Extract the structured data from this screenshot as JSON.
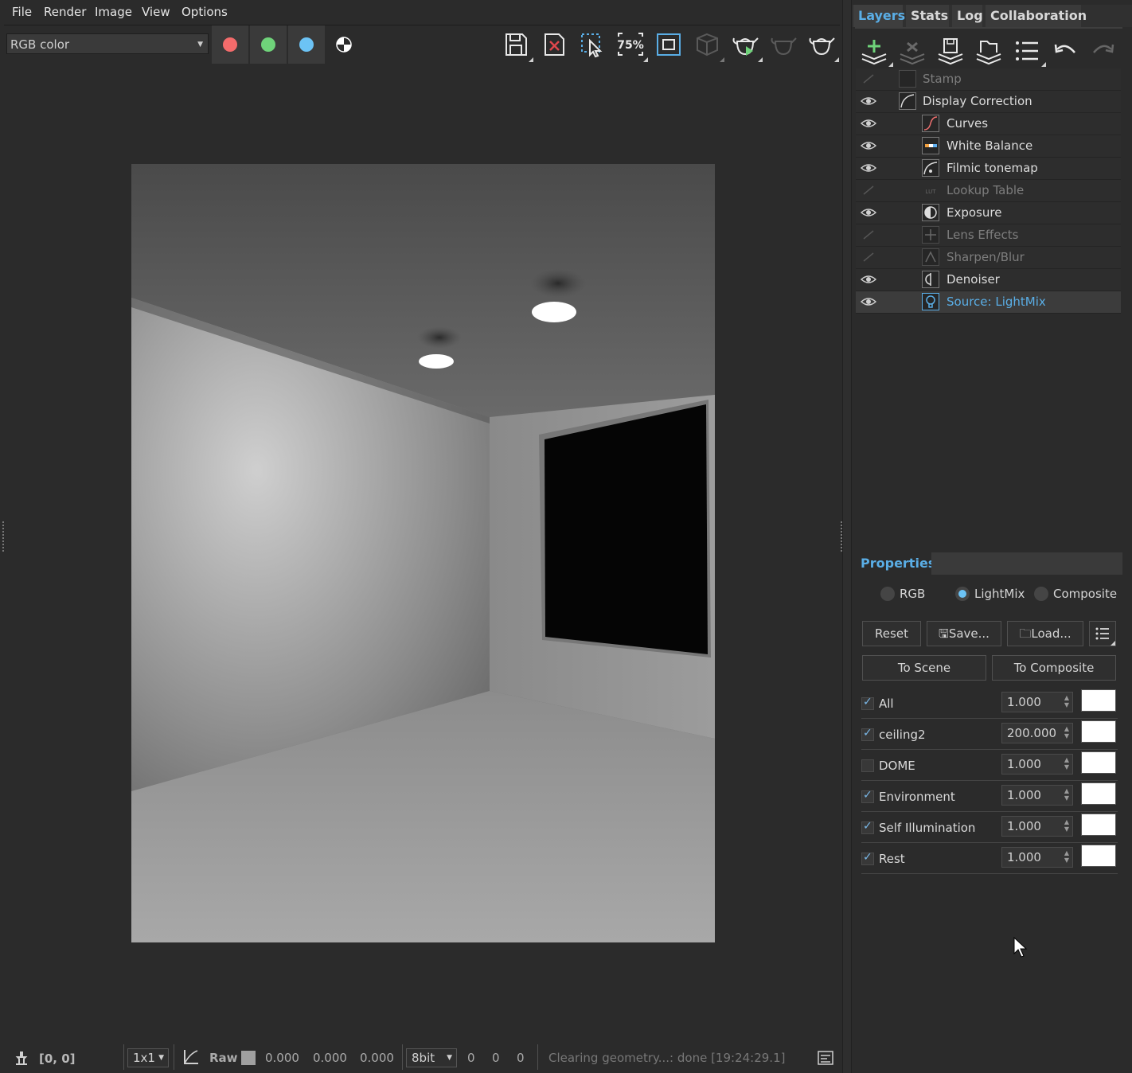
{
  "menu": [
    "File",
    "Render",
    "Image",
    "View",
    "Options"
  ],
  "toolbar": {
    "channel": "RGB color",
    "channel_colors": {
      "red": "#f36b6b",
      "green": "#6fd37a",
      "blue": "#6cc3f5"
    },
    "zoom_label": "75%"
  },
  "tabs": [
    "Layers",
    "Stats",
    "Log",
    "Collaboration"
  ],
  "accent_color": "#5aaee6",
  "layers": [
    {
      "name": "Stamp",
      "visible": false,
      "indent": 0
    },
    {
      "name": "Display Correction",
      "visible": true,
      "indent": 0
    },
    {
      "name": "Curves",
      "visible": true,
      "indent": 1
    },
    {
      "name": "White Balance",
      "visible": true,
      "indent": 1
    },
    {
      "name": "Filmic tonemap",
      "visible": true,
      "indent": 1
    },
    {
      "name": "Lookup Table",
      "visible": false,
      "indent": 1
    },
    {
      "name": "Exposure",
      "visible": true,
      "indent": 1
    },
    {
      "name": "Lens Effects",
      "visible": false,
      "indent": 1
    },
    {
      "name": "Sharpen/Blur",
      "visible": false,
      "indent": 1
    },
    {
      "name": "Denoiser",
      "visible": true,
      "indent": 1
    },
    {
      "name": "Source: LightMix",
      "visible": true,
      "indent": 1,
      "selected": true
    }
  ],
  "properties": {
    "title": "Properties",
    "modes": [
      {
        "label": "RGB",
        "selected": false
      },
      {
        "label": "LightMix",
        "selected": true
      },
      {
        "label": "Composite",
        "selected": false
      }
    ],
    "reset": "Reset",
    "save": "Save...",
    "load": "Load...",
    "to_scene": "To Scene",
    "to_composite": "To Composite",
    "lights": [
      {
        "name": "All",
        "checked": true,
        "value": "1.000",
        "color": "#ffffff"
      },
      {
        "name": "ceiling2",
        "checked": true,
        "value": "200.000",
        "color": "#ffffff"
      },
      {
        "name": "DOME",
        "checked": false,
        "value": "1.000",
        "color": "#ffffff"
      },
      {
        "name": "Environment",
        "checked": true,
        "value": "1.000",
        "color": "#ffffff"
      },
      {
        "name": "Self Illumination",
        "checked": true,
        "value": "1.000",
        "color": "#ffffff"
      },
      {
        "name": "Rest",
        "checked": true,
        "value": "1.000",
        "color": "#ffffff"
      }
    ]
  },
  "status": {
    "coords": "[0, 0]",
    "sampling": "1x1",
    "raw_label": "Raw",
    "raw_values": [
      "0.000",
      "0.000",
      "0.000"
    ],
    "bitdepth": "8bit",
    "int_values": [
      "0",
      "0",
      "0"
    ],
    "message": "Clearing geometry...: done [19:24:29.1]"
  }
}
